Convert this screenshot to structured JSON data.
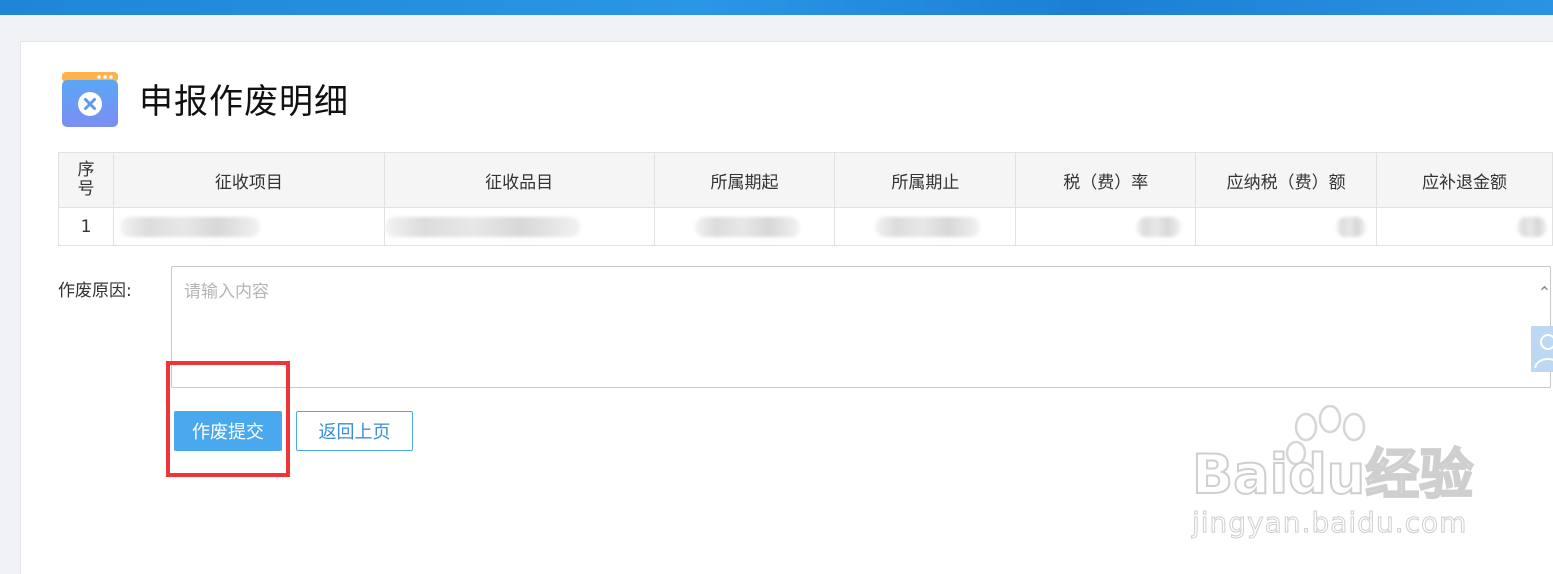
{
  "page": {
    "title": "申报作废明细"
  },
  "table": {
    "headers": [
      "序号",
      "征收项目",
      "征收品目",
      "所属期起",
      "所属期止",
      "税（费）率",
      "应纳税（费）额",
      "应补退金额"
    ],
    "seq_header_lines": [
      "序",
      "号"
    ],
    "rows": [
      {
        "seq": "1"
      }
    ]
  },
  "form": {
    "reason_label": "作废原因:",
    "reason_placeholder": "请输入内容",
    "reason_value": ""
  },
  "buttons": {
    "submit_label": "作废提交",
    "back_label": "返回上页"
  },
  "watermark": {
    "brand_text": "Baidu经验",
    "url_text": "jingyan.baidu.com"
  },
  "colors": {
    "primary": "#4aa9ee",
    "highlight": "#f0353a",
    "header_bar": "#1f86d6"
  },
  "icons": {
    "title_icon": "close-window-icon",
    "scroll": "chevron-up-icon",
    "avatar": "user-icon"
  }
}
